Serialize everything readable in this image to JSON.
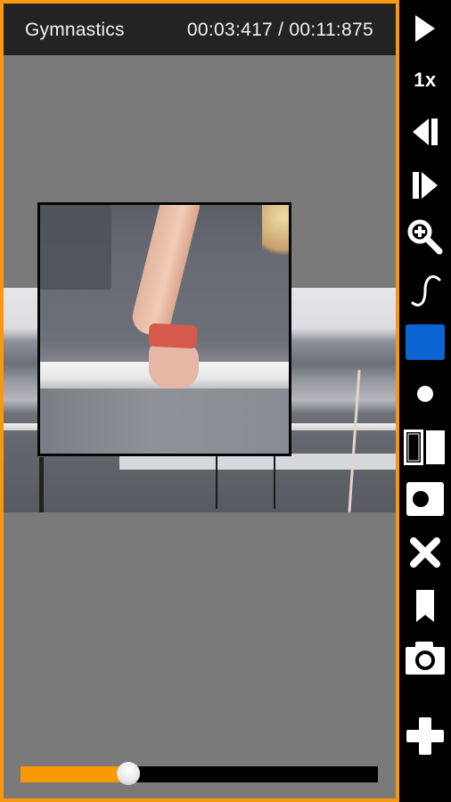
{
  "player": {
    "title": "Gymnastics",
    "current_time": "00:03:417",
    "total_time": "00:11:875",
    "time_separator": " / ",
    "time_display": "00:03:417 / 00:11:875",
    "progress_fraction": 0.288,
    "frame_color": "#f7990e",
    "progress_color": "#fb9a00"
  },
  "toolbar": {
    "items": [
      {
        "name": "play",
        "icon": "play-icon"
      },
      {
        "name": "speed",
        "icon": "speed-label",
        "label": "1x"
      },
      {
        "name": "step-back",
        "icon": "step-back-icon"
      },
      {
        "name": "step-forward",
        "icon": "step-forward-icon"
      },
      {
        "name": "zoom-in",
        "icon": "zoom-in-icon"
      },
      {
        "name": "draw-curve",
        "icon": "curve-icon"
      },
      {
        "name": "color",
        "icon": "color-swatch",
        "color": "#0a64d2"
      },
      {
        "name": "stroke-size",
        "icon": "dot-icon"
      },
      {
        "name": "split-view",
        "icon": "split-view-icon"
      },
      {
        "name": "record",
        "icon": "record-icon"
      },
      {
        "name": "clear",
        "icon": "close-icon"
      },
      {
        "name": "bookmark",
        "icon": "bookmark-icon"
      },
      {
        "name": "snapshot",
        "icon": "camera-icon"
      },
      {
        "name": "add",
        "icon": "plus-icon"
      }
    ]
  }
}
